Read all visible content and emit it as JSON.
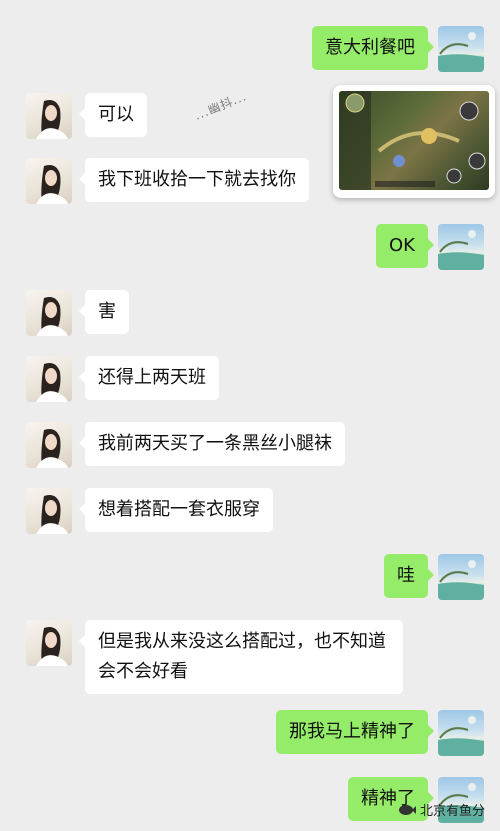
{
  "messages": [
    {
      "side": "out",
      "text": "意大利餐吧"
    },
    {
      "side": "in",
      "text": "可以"
    },
    {
      "side": "in",
      "text": "我下班收拾一下就去找你"
    },
    {
      "side": "out",
      "text": "OK"
    },
    {
      "side": "in",
      "text": "害"
    },
    {
      "side": "in",
      "text": "还得上两天班"
    },
    {
      "side": "in",
      "text": "我前两天买了一条黑丝小腿袜"
    },
    {
      "side": "in",
      "text": "想着搭配一套衣服穿"
    },
    {
      "side": "out",
      "text": "哇"
    },
    {
      "side": "in",
      "text": "但是我从来没这么搭配过，也不知道会不会好看"
    },
    {
      "side": "out",
      "text": "那我马上精神了"
    },
    {
      "side": "out",
      "text": "精神了"
    }
  ],
  "watermark": {
    "text": "...幽抖..."
  },
  "footer_badge": {
    "text": "北京有鱼分"
  },
  "icons": {
    "contact_avatar": "girl-avatar-icon",
    "self_avatar": "beach-avatar-icon",
    "floating_window": "game-video-icon"
  }
}
